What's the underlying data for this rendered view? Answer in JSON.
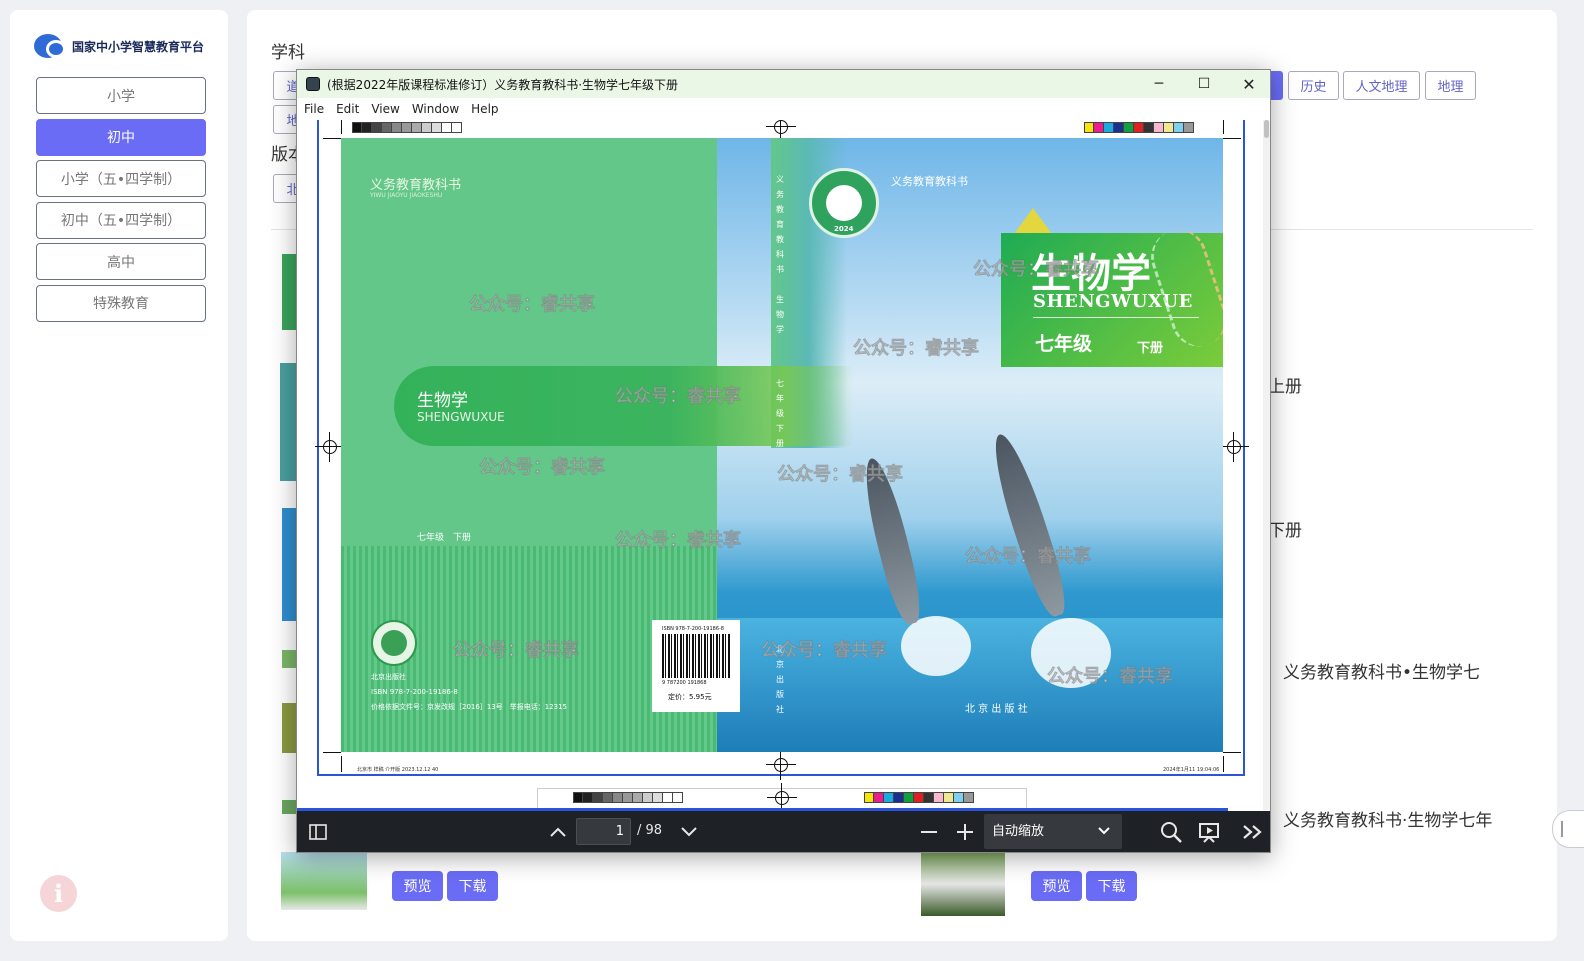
{
  "sidebar": {
    "logo_text": "国家中小学智慧教育平台",
    "levels": [
      {
        "label": "小学",
        "active": false
      },
      {
        "label": "初中",
        "active": true
      },
      {
        "label": "小学（五•四学制）",
        "active": false
      },
      {
        "label": "初中（五•四学制）",
        "active": false
      },
      {
        "label": "高中",
        "active": false
      },
      {
        "label": "特殊教育",
        "active": false
      }
    ],
    "info_icon": "i"
  },
  "main": {
    "subject_label": "学科",
    "edition_label": "版本",
    "subject_chips_visible": {
      "first_partial": "道",
      "second_row_partial": "地",
      "history": "历史",
      "humanities_geo": "人文地理",
      "geography": "地理"
    },
    "edition_chip_partial": "北",
    "books": {
      "title_right_1": "上册",
      "title_right_2": "下册",
      "title_right_3": "义务教育教科书•生物学七",
      "title_right_4": "义务教育教科书·生物学七年"
    },
    "buttons": {
      "preview": "预览",
      "download": "下载"
    }
  },
  "viewer": {
    "title": "(根据2022年版课程标准修订）义务教育教科书·生物学七年级下册",
    "menu": [
      "File",
      "Edit",
      "View",
      "Window",
      "Help"
    ],
    "window_controls": {
      "minimize": "─",
      "maximize": "☐",
      "close": "✕"
    },
    "page_current": "1",
    "page_total": "/ 98",
    "zoom_label": "自动缩放",
    "colors": {
      "accent": "#2b55d6",
      "toolbar_bg": "#1e2125"
    }
  },
  "cover": {
    "series_cn": "义务教育教科书",
    "series_pinyin": "YIWU JIAOYU JIAOKESHU",
    "front_series": "义务教育教科书",
    "emblem_year": "2024",
    "subject_cn": "生物学",
    "subject_pinyin": "SHENGWUXUE",
    "grade": "七年级",
    "volume": "下册",
    "back_subject_cn": "生物学",
    "back_subject_pinyin": "SHENGWUXUE",
    "back_grade_volume": "七年级　下册",
    "spine_series": "义务教育教科书",
    "spine_subject": "生物学",
    "spine_grade": "七年级下册",
    "spine_publisher": "北京出版社",
    "publisher": "北 京 出 版 社",
    "seal_label": "北京出版社",
    "isbn": "ISBN 978-7-200-19186-8",
    "price_doc": "价格依据文件号：京发改规［2016］13号　举报电话：12315",
    "barcode_top": "ISBN 978-7-200-19186-8",
    "barcode_number": "9 787200 191868",
    "price": "定价：5.95元",
    "watermark": "公众号：睿共享",
    "print_note_left": "北京市 样稿 介开版 2023.12.12 40",
    "print_note_right": "2024年1月11 19:04:06"
  }
}
